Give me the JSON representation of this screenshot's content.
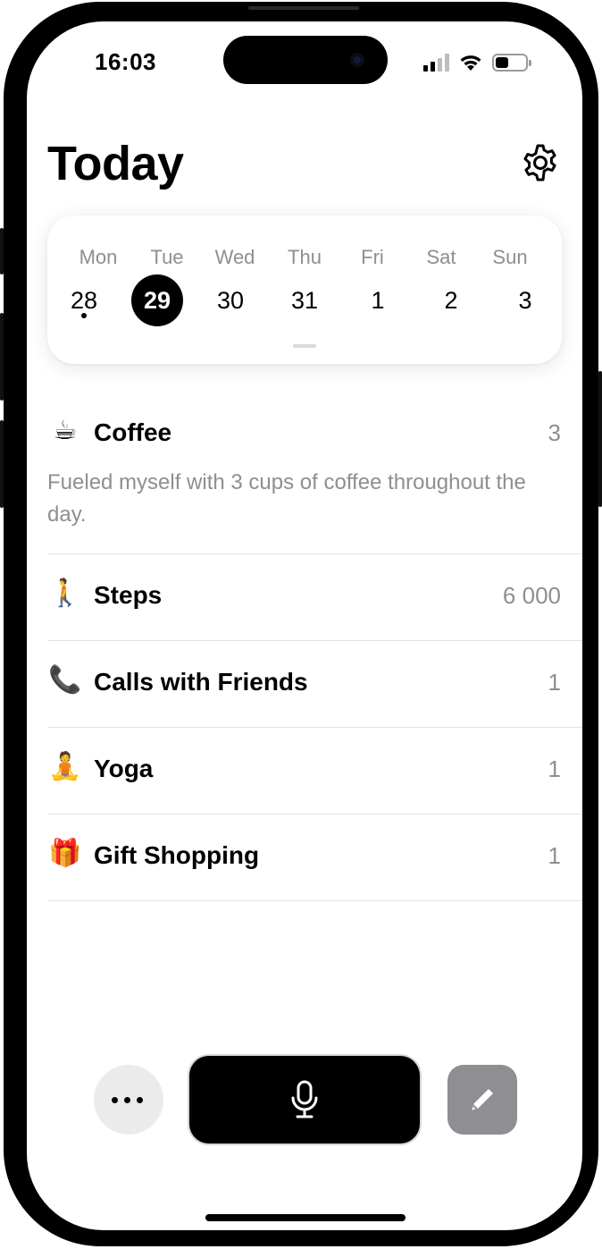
{
  "status_bar": {
    "time": "16:03",
    "signal_bars": 4,
    "signal_active": 2,
    "battery_level": 0.45
  },
  "header": {
    "title": "Today",
    "settings_icon": "gear-icon"
  },
  "week": {
    "days": [
      {
        "name": "Mon",
        "date": "28",
        "has_entry": true,
        "selected": false
      },
      {
        "name": "Tue",
        "date": "29",
        "has_entry": false,
        "selected": true
      },
      {
        "name": "Wed",
        "date": "30",
        "has_entry": false,
        "selected": false
      },
      {
        "name": "Thu",
        "date": "31",
        "has_entry": false,
        "selected": false
      },
      {
        "name": "Fri",
        "date": "1",
        "has_entry": false,
        "selected": false
      },
      {
        "name": "Sat",
        "date": "2",
        "has_entry": false,
        "selected": false
      },
      {
        "name": "Sun",
        "date": "3",
        "has_entry": false,
        "selected": false
      }
    ]
  },
  "entries": [
    {
      "emoji": "☕",
      "title": "Coffee",
      "count": "3",
      "note": "Fueled myself with 3 cups of coffee throughout the day."
    },
    {
      "emoji": "🚶",
      "title": "Steps",
      "count": "6 000"
    },
    {
      "emoji": "📞",
      "title": "Calls with Friends",
      "count": "1"
    },
    {
      "emoji": "🧘",
      "title": "Yoga",
      "count": "1"
    },
    {
      "emoji": "🎁",
      "title": "Gift Shopping",
      "count": "1"
    }
  ],
  "toolbar": {
    "more_icon": "more-icon",
    "mic_icon": "microphone-icon",
    "edit_icon": "pencil-icon"
  },
  "colors": {
    "accent": "#000000",
    "secondary_text": "#8e8e93",
    "edit_button": "#8e8e93"
  }
}
